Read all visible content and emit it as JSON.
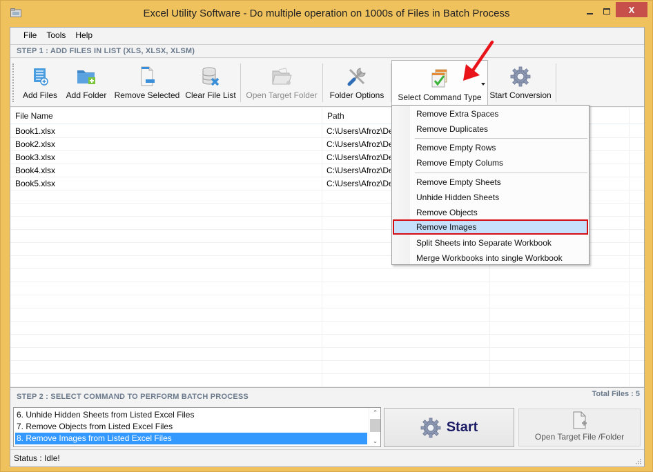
{
  "window": {
    "title": "Excel Utility Software - Do multiple operation on 1000s of Files in Batch Process",
    "controls": {
      "minimize": "minimize",
      "maximize": "maximize",
      "close": "X"
    },
    "frame_color": "#f0c25e",
    "close_color": "#c7504a"
  },
  "menu": [
    "File",
    "Tools",
    "Help"
  ],
  "step1": {
    "label": "STEP 1 : ADD FILES IN LIST (XLS, XLSX, XLSM)"
  },
  "toolbar": {
    "buttons": [
      {
        "label": "Add Files",
        "icon": "add-files-icon",
        "enabled": true
      },
      {
        "label": "Add Folder",
        "icon": "add-folder-icon",
        "enabled": true
      },
      {
        "label": "Remove Selected",
        "icon": "remove-selected-icon",
        "enabled": true
      },
      {
        "label": "Clear File List",
        "icon": "clear-list-icon",
        "enabled": true
      },
      {
        "label": "Open Target Folder",
        "icon": "open-folder-icon",
        "enabled": false
      },
      {
        "label": "Folder Options",
        "icon": "tools-icon",
        "enabled": true
      },
      {
        "label": "Select Command Type",
        "icon": "checklist-icon",
        "enabled": true,
        "dropdown_open": true
      },
      {
        "label": "Start Conversion",
        "icon": "gear-icon",
        "enabled": true
      }
    ]
  },
  "file_grid": {
    "columns": [
      "File Name",
      "Path",
      "",
      ""
    ],
    "rows": [
      {
        "name": "Book1.xlsx",
        "path": "C:\\Users\\Afroz\\De"
      },
      {
        "name": "Book2.xlsx",
        "path": "C:\\Users\\Afroz\\De"
      },
      {
        "name": "Book3.xlsx",
        "path": "C:\\Users\\Afroz\\De"
      },
      {
        "name": "Book4.xlsx",
        "path": "C:\\Users\\Afroz\\De"
      },
      {
        "name": "Book5.xlsx",
        "path": "C:\\Users\\Afroz\\De"
      }
    ]
  },
  "command_menu": {
    "groups": [
      [
        "Remove Extra Spaces",
        "Remove Duplicates"
      ],
      [
        "Remove Empty Rows",
        "Remove Empty Colums"
      ],
      [
        "Remove Empty Sheets",
        "Unhide Hidden Sheets",
        "Remove Objects",
        "Remove Images",
        "Split Sheets into Separate Workbook",
        "Merge Workbooks into single Workbook"
      ]
    ],
    "highlighted": "Remove Images",
    "highlight_color": "#c6dffa",
    "annotation_color": "#d40d12"
  },
  "step2": {
    "label": "STEP 2 : SELECT COMMAND TO PERFORM BATCH PROCESS",
    "total_files_label": "Total Files : 5",
    "commands_visible": [
      "6. Unhide Hidden Sheets from Listed Excel Files",
      "7. Remove Objects from Listed Excel Files",
      "8. Remove Images from Listed Excel Files"
    ],
    "selected_index": 2,
    "selection_color": "#3399ff",
    "start_label": "Start",
    "open_target_label": "Open Target File /Folder"
  },
  "status": {
    "text": "Status  :  Idle!"
  }
}
